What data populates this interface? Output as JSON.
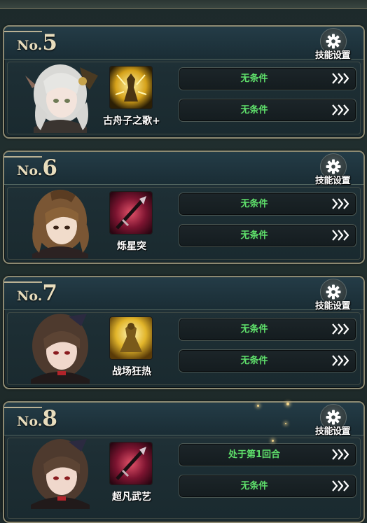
{
  "colors": {
    "condition_text": "#5fe06b",
    "header_text": "#e8ddbd",
    "card_border": "#8d8a72"
  },
  "icons": {
    "settings": "gear-icon",
    "condition_next": "triple-chevron-right-icon"
  },
  "slots": [
    {
      "no_prefix": "No.",
      "number": "5",
      "settings_label": "技能设置",
      "skill_name": "古舟子之歌+",
      "skill_icon": "golden-warrior-icon",
      "character": "white-haired-girl",
      "conditions": [
        "无条件",
        "无条件"
      ]
    },
    {
      "no_prefix": "No.",
      "number": "6",
      "settings_label": "技能设置",
      "skill_name": "烁星突",
      "skill_icon": "crimson-spear-icon",
      "character": "brown-haired-girl",
      "conditions": [
        "无条件",
        "无条件"
      ]
    },
    {
      "no_prefix": "No.",
      "number": "7",
      "settings_label": "技能设置",
      "skill_name": "战场狂热",
      "skill_icon": "golden-warrior-icon",
      "character": "dark-haired-girl",
      "conditions": [
        "无条件",
        "无条件"
      ]
    },
    {
      "no_prefix": "No.",
      "number": "8",
      "settings_label": "技能设置",
      "skill_name": "超凡武艺",
      "skill_icon": "crimson-spear-icon",
      "character": "dark-haired-girl",
      "conditions": [
        "处于第1回合",
        "无条件"
      ]
    }
  ]
}
